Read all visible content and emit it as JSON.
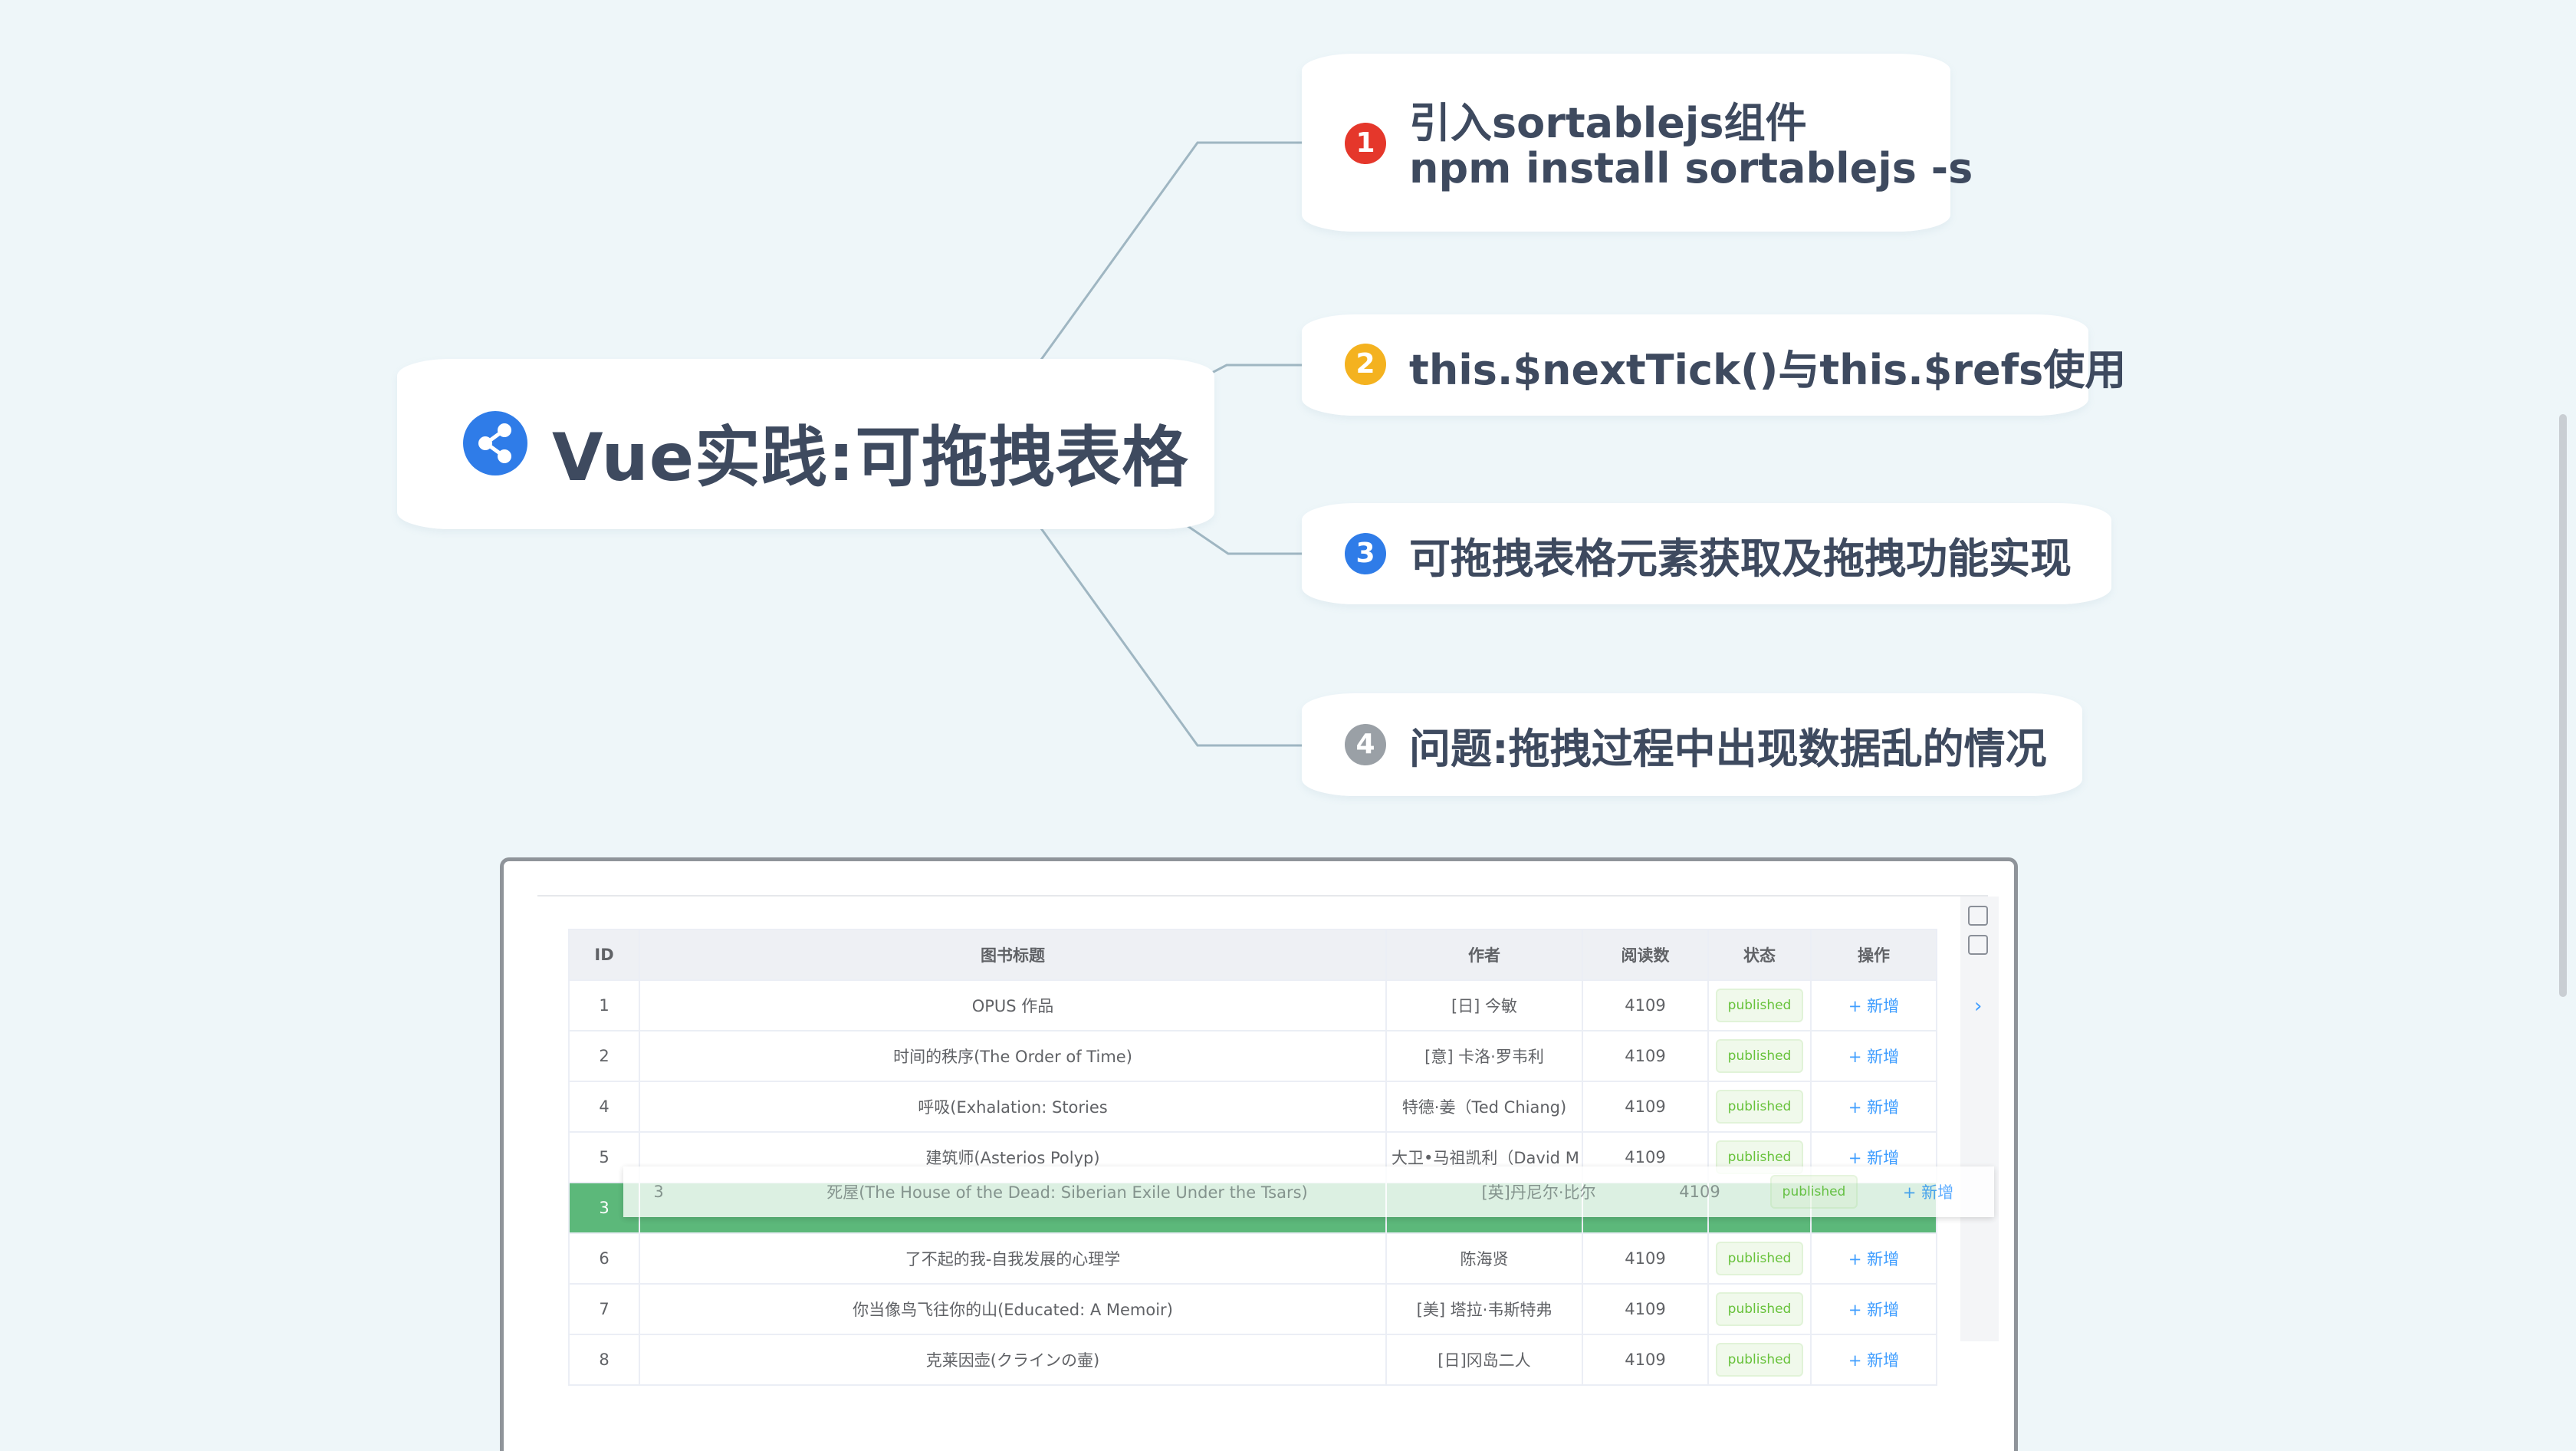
{
  "root": {
    "title": "Vue实践:可拖拽表格",
    "icon": "share-icon"
  },
  "branches": [
    {
      "number": "1",
      "color": "#e5372b",
      "lines": [
        "引入sortablejs组件",
        "npm install sortablejs -s"
      ]
    },
    {
      "number": "2",
      "color": "#f4b21f",
      "lines": [
        "this.$nextTick()与this.$refs使用"
      ]
    },
    {
      "number": "3",
      "color": "#2f7ce8",
      "lines": [
        "可拖拽表格元素获取及拖拽功能实现"
      ]
    },
    {
      "number": "4",
      "color": "#9aa0a6",
      "lines": [
        "问题:拖拽过程中出现数据乱的情况"
      ]
    }
  ],
  "table": {
    "headers": [
      "ID",
      "图书标题",
      "作者",
      "阅读数",
      "状态",
      "操作"
    ],
    "rows": [
      {
        "id": "1",
        "title": "OPUS 作品",
        "author": "[日] 今敏",
        "reads": "4109",
        "status": "published",
        "op": "+ 新增"
      },
      {
        "id": "2",
        "title": "时间的秩序(The Order of Time)",
        "author": "[意] 卡洛·罗韦利",
        "reads": "4109",
        "status": "published",
        "op": "+ 新增"
      },
      {
        "id": "4",
        "title": "呼吸(Exhalation: Stories",
        "author": "特德·姜（Ted Chiang)",
        "reads": "4109",
        "status": "published",
        "op": "+ 新增"
      },
      {
        "id": "5",
        "title": "建筑师(Asterios Polyp)",
        "author": "大卫•马祖凯利（David M",
        "reads": "4109",
        "status": "published",
        "op": "+ 新增"
      },
      {
        "id": "3",
        "title": "",
        "author": "",
        "reads": "",
        "status": "",
        "op": ""
      },
      {
        "id": "6",
        "title": "了不起的我-自我发展的心理学",
        "author": "陈海贤",
        "reads": "4109",
        "status": "published",
        "op": "+ 新增"
      },
      {
        "id": "7",
        "title": "你当像鸟飞往你的山(Educated: A Memoir)",
        "author": "[美] 塔拉·韦斯特弗",
        "reads": "4109",
        "status": "published",
        "op": "+ 新增"
      },
      {
        "id": "8",
        "title": "克莱因壶(クラインの壷)",
        "author": "[日]冈岛二人",
        "reads": "4109",
        "status": "published",
        "op": "+ 新增"
      }
    ],
    "dragging": {
      "id": "3",
      "title": "死屋(The House of the Dead: Siberian Exile Under the Tsars)",
      "author": "[英]丹尼尔·比尔",
      "reads": "4109",
      "status": "published",
      "op": "+ 新增"
    }
  }
}
